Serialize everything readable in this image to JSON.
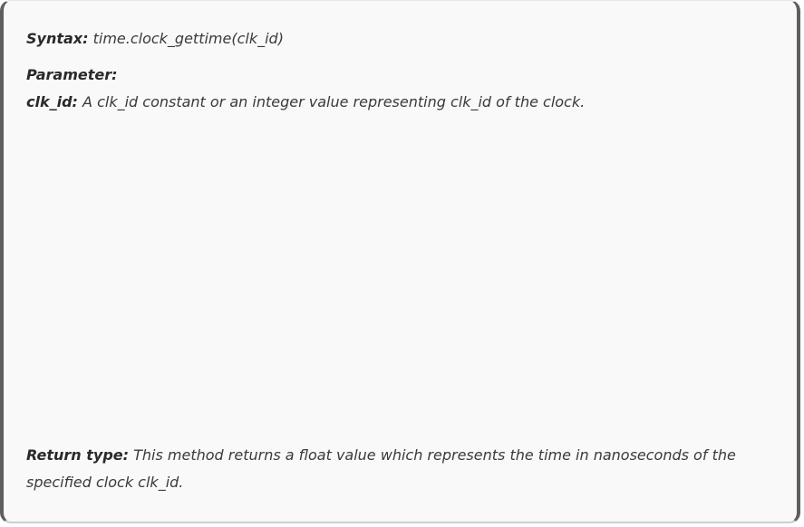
{
  "syntax": {
    "label": "Syntax:",
    "value": " time.clock_gettime(clk_id)"
  },
  "parameter": {
    "heading": "Parameter:"
  },
  "clk_id": {
    "label": "clk_id:",
    "value": " A clk_id constant or an integer value representing clk_id of the clock."
  },
  "return_type": {
    "label": "Return type:",
    "value_line1": " This method returns a float value which represents the time in nanoseconds of the",
    "value_line2": "specified clock clk_id."
  }
}
